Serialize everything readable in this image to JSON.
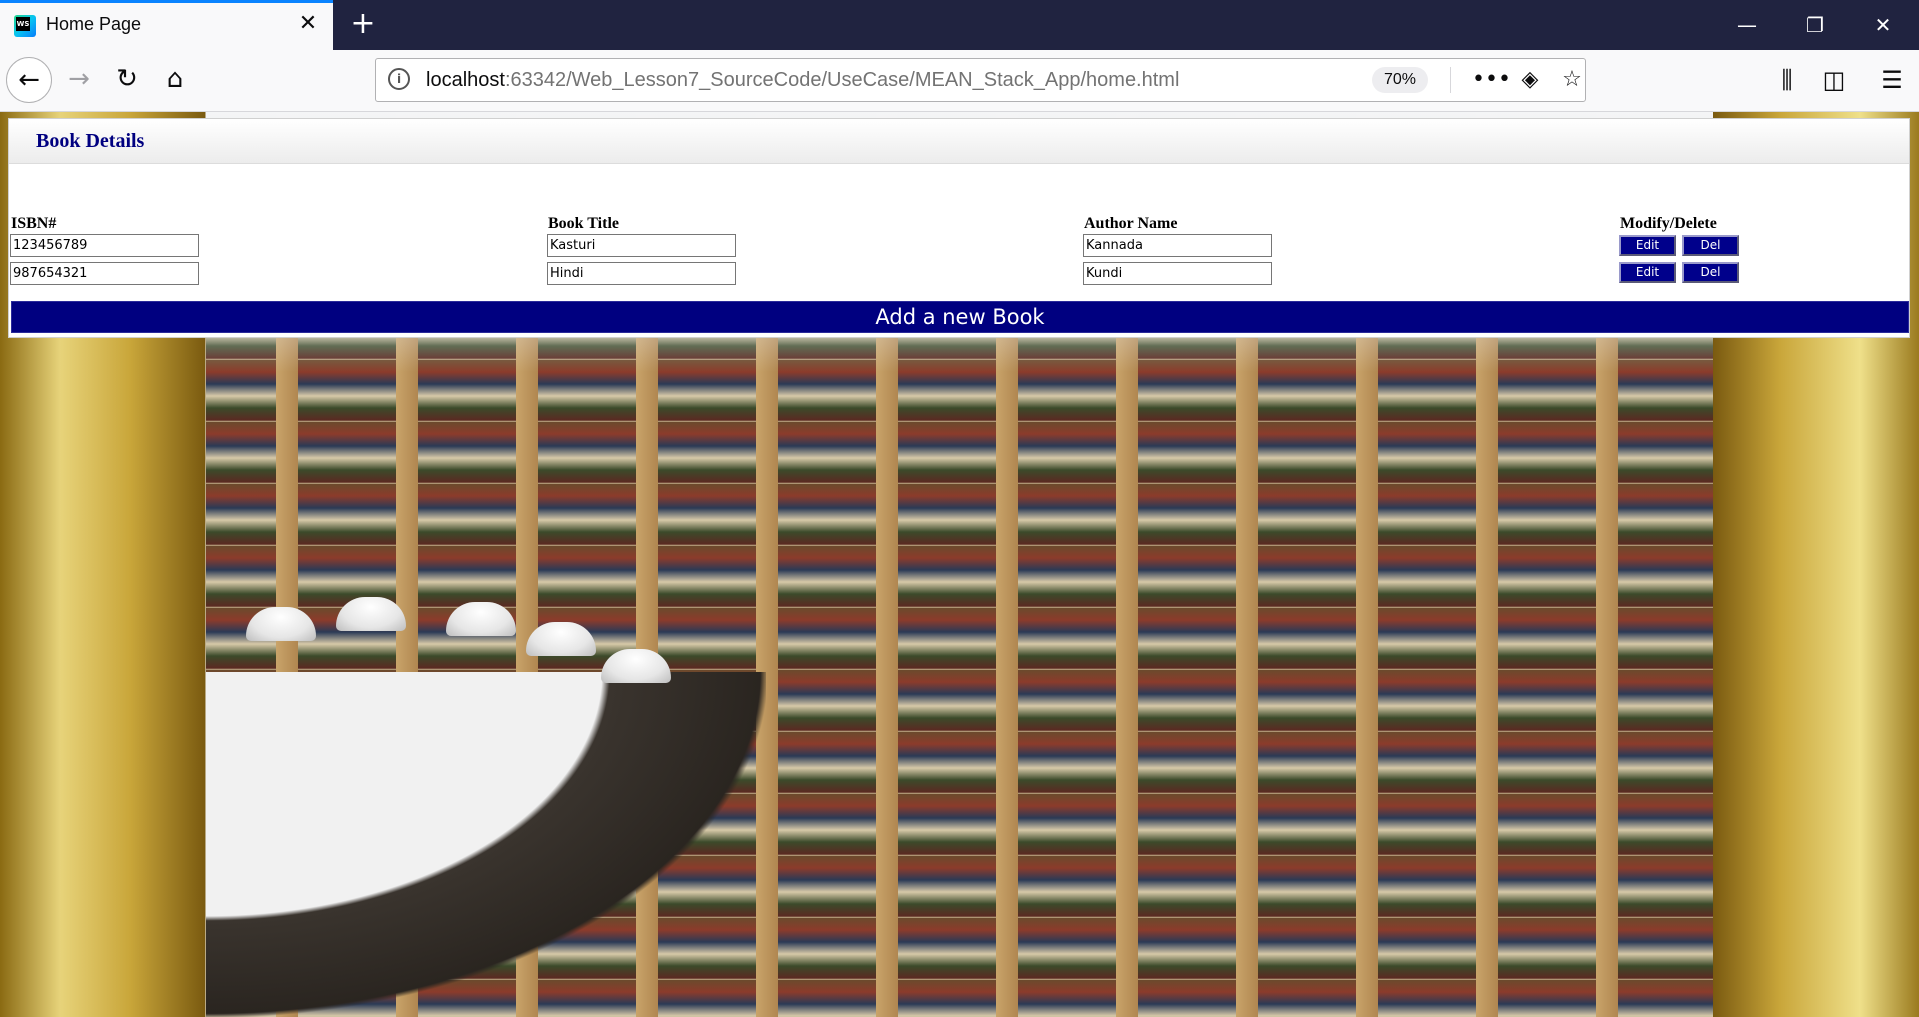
{
  "browser": {
    "tab_title": "Home Page",
    "tab_close": "✕",
    "new_tab": "+",
    "url_host": "localhost",
    "url_rest": ":63342/Web_Lesson7_SourceCode/UseCase/MEAN_Stack_App/home.html",
    "zoom": "70%",
    "icons": [
      "back-icon",
      "forward-icon",
      "reload-icon",
      "home-icon",
      "info-icon",
      "page-actions-icon",
      "pocket-icon",
      "bookmark-star-icon",
      "library-icon",
      "sidebar-icon",
      "menu-icon",
      "minimize-icon",
      "restore-icon",
      "close-window-icon"
    ]
  },
  "page": {
    "panel_title": "Book Details",
    "headers": {
      "isbn": "ISBN#",
      "title": "Book Title",
      "author": "Author Name",
      "actions": "Modify/Delete"
    },
    "rows": [
      {
        "isbn": "123456789",
        "title": "Kasturi",
        "author": "Kannada",
        "edit": "Edit",
        "del": "Del"
      },
      {
        "isbn": "987654321",
        "title": "Hindi",
        "author": "Kundi",
        "edit": "Edit",
        "del": "Del"
      }
    ],
    "add_button": "Add a new Book"
  },
  "colors": {
    "tabbar": "#202340",
    "accent_navy": "#000080",
    "button_blue": "#00008b"
  }
}
